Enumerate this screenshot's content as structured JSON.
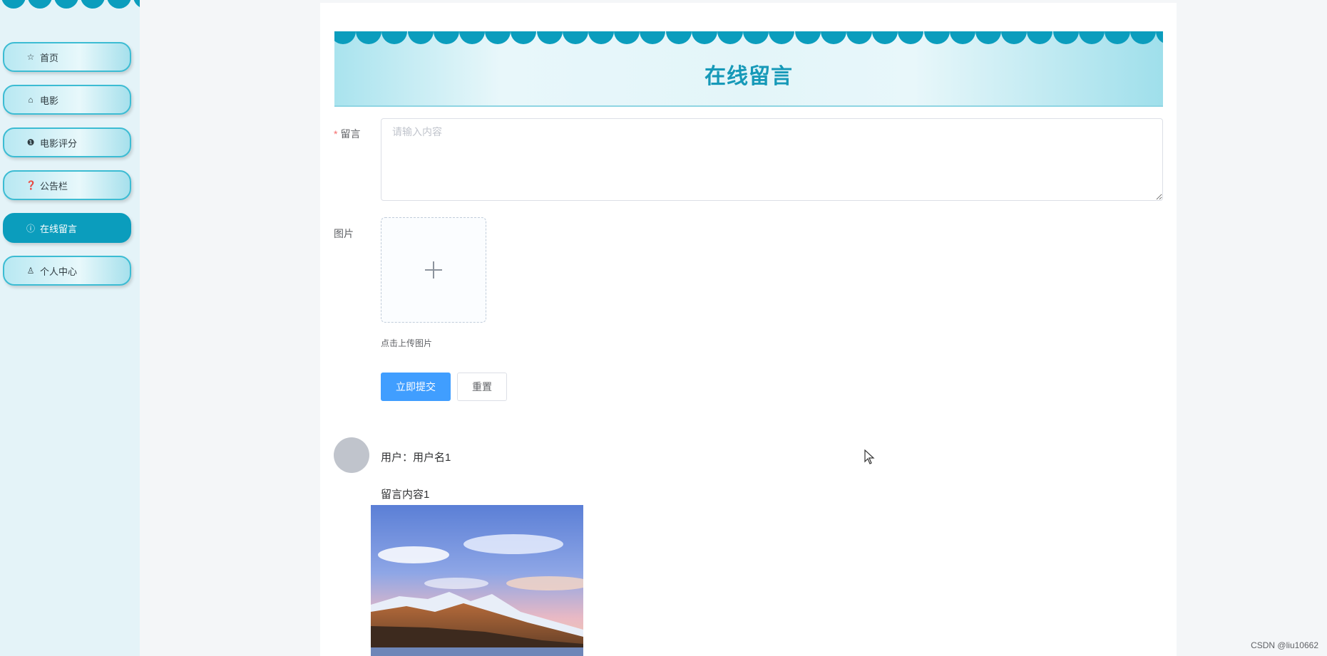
{
  "sidebar": {
    "items": [
      {
        "label": "首页",
        "icon": "star-icon"
      },
      {
        "label": "电影",
        "icon": "bag-icon"
      },
      {
        "label": "电影评分",
        "icon": "alert-circle-icon"
      },
      {
        "label": "公告栏",
        "icon": "question-circle-icon"
      },
      {
        "label": "在线留言",
        "icon": "info-circle-icon",
        "active": true
      },
      {
        "label": "个人中心",
        "icon": "user-icon"
      }
    ]
  },
  "page": {
    "title": "在线留言"
  },
  "form": {
    "message_label": "留言",
    "message_required_mark": "*",
    "message_placeholder": "请输入内容",
    "image_label": "图片",
    "upload_hint": "点击上传图片",
    "submit_label": "立即提交",
    "reset_label": "重置"
  },
  "messages": [
    {
      "user": "用户：用户名1",
      "content": "留言内容1"
    }
  ],
  "footer": {
    "watermark": "CSDN @liu10662"
  },
  "colors": {
    "accent": "#0b9dbd",
    "primary_button": "#409eff",
    "required": "#f56c6c"
  }
}
